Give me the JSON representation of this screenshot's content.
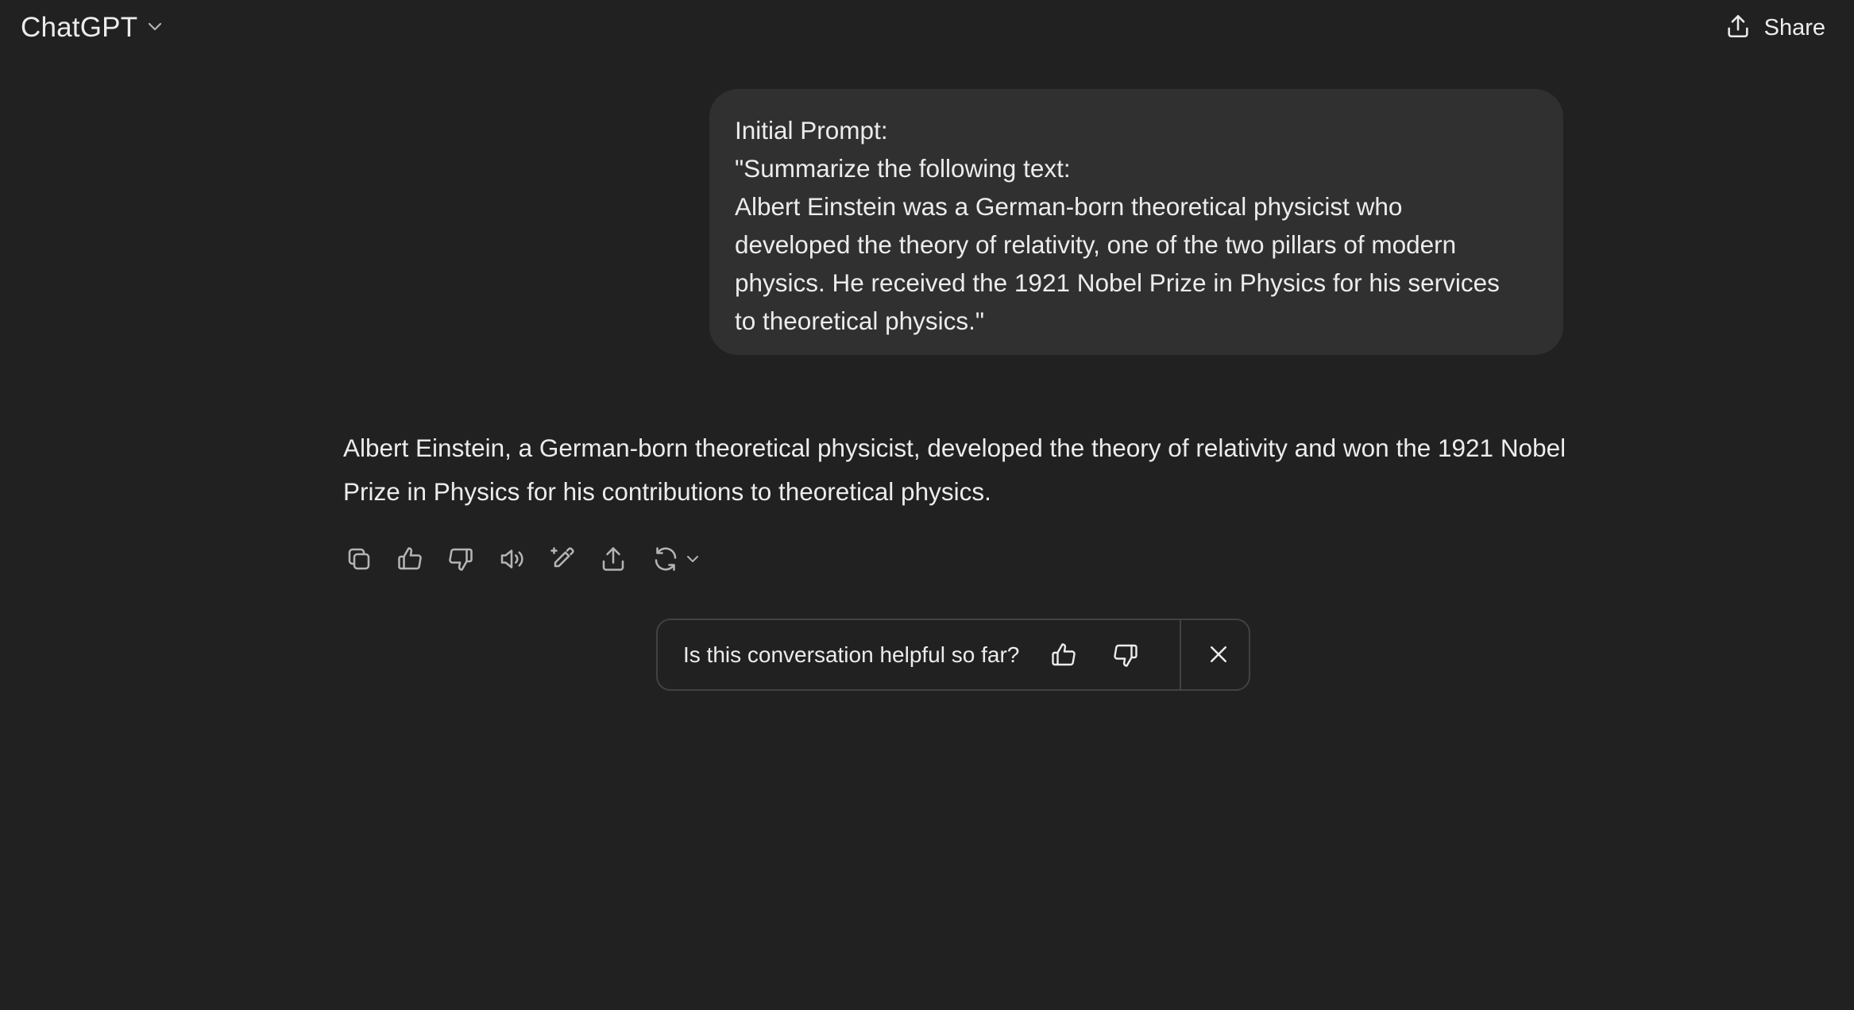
{
  "header": {
    "model_name": "ChatGPT",
    "share_label": "Share"
  },
  "conversation": {
    "user_message_lines": [
      "Initial Prompt:",
      "\"Summarize the following text:",
      "Albert Einstein was a German-born theoretical physicist who",
      "developed the theory of relativity, one of the two pillars of modern",
      "physics. He received the 1921 Nobel Prize in Physics for his services",
      "to theoretical physics.\""
    ],
    "assistant_message": "Albert Einstein, a German-born theoretical physicist, developed the theory of relativity and won the 1921 Nobel Prize in Physics for his contributions to theoretical physics."
  },
  "message_actions": [
    "copy-icon",
    "thumbs-up-icon",
    "thumbs-down-icon",
    "read-aloud-icon",
    "edit-sparkle-icon",
    "share-icon",
    "regenerate-icon"
  ],
  "feedback": {
    "question": "Is this conversation helpful so far?"
  },
  "colors": {
    "background": "#212121",
    "user_bubble": "#303030",
    "text": "#ececec",
    "border": "#424242"
  }
}
